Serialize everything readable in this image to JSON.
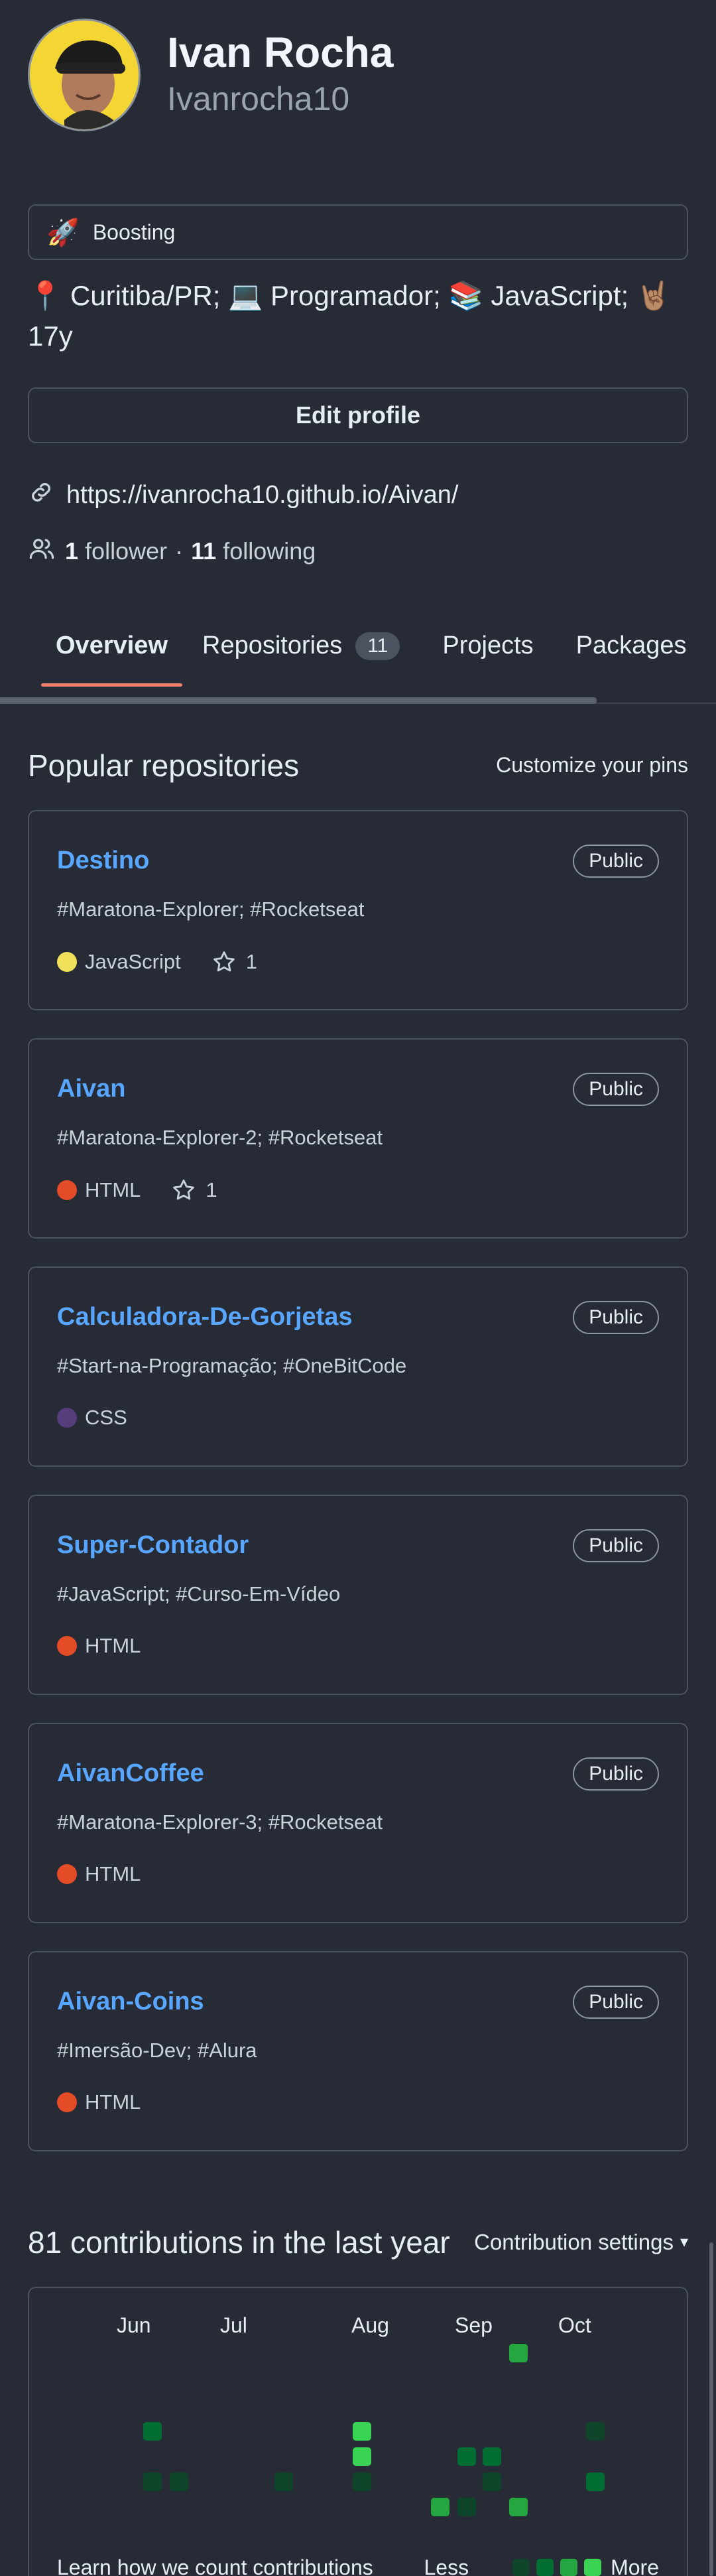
{
  "profile": {
    "full_name": "Ivan Rocha",
    "username": "Ivanrocha10",
    "status_emoji": "🚀",
    "status_text": "Boosting",
    "bio": "📍 Curitiba/PR; 💻 Programador; 📚 JavaScript; 🤘🏽 17y",
    "edit_label": "Edit profile",
    "website": "https://ivanrocha10.github.io/Aivan/",
    "followers_count": "1",
    "followers_label": "follower",
    "separator": "·",
    "following_count": "11",
    "following_label": "following"
  },
  "tabs": [
    {
      "label": "Overview",
      "active": true
    },
    {
      "label": "Repositories",
      "count": "11"
    },
    {
      "label": "Projects"
    },
    {
      "label": "Packages"
    }
  ],
  "popular": {
    "title": "Popular repositories",
    "customize_label": "Customize your pins",
    "repos": [
      {
        "name": "Destino",
        "visibility": "Public",
        "description": "#Maratona-Explorer; #Rocketseat",
        "language": "JavaScript",
        "language_color": "#f1e05a",
        "stars": "1"
      },
      {
        "name": "Aivan",
        "visibility": "Public",
        "description": "#Maratona-Explorer-2; #Rocketseat",
        "language": "HTML",
        "language_color": "#e34c26",
        "stars": "1"
      },
      {
        "name": "Calculadora-De-Gorjetas",
        "visibility": "Public",
        "description": "#Start-na-Programação; #OneBitCode",
        "language": "CSS",
        "language_color": "#563d7c"
      },
      {
        "name": "Super-Contador",
        "visibility": "Public",
        "description": "#JavaScript; #Curso-Em-Vídeo",
        "language": "HTML",
        "language_color": "#e34c26"
      },
      {
        "name": "AivanCoffee",
        "visibility": "Public",
        "description": "#Maratona-Explorer-3; #Rocketseat",
        "language": "HTML",
        "language_color": "#e34c26"
      },
      {
        "name": "Aivan-Coins",
        "visibility": "Public",
        "description": "#Imersão-Dev; #Alura",
        "language": "HTML",
        "language_color": "#e34c26"
      }
    ]
  },
  "contributions": {
    "title": "81 contributions in the last year",
    "settings_label": "Contribution settings",
    "months": [
      "Jun",
      "Jul",
      "Aug",
      "Sep",
      "Oct"
    ],
    "learn_label": "Learn how we count contributions",
    "less_label": "Less",
    "more_label": "More"
  },
  "colors": {
    "background": "#262b35",
    "link": "#58a6ff",
    "active_tab_underline": "#f0816b"
  }
}
